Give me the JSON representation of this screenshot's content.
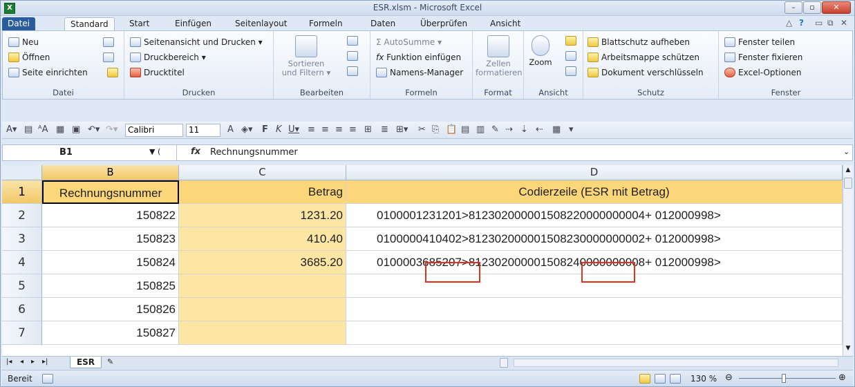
{
  "window": {
    "title": "ESR.xlsm - Microsoft Excel",
    "app_icon": "X"
  },
  "tabs": [
    "Datei",
    "Standard",
    "Start",
    "Einfügen",
    "Seitenlayout",
    "Formeln",
    "Daten",
    "Überprüfen",
    "Ansicht"
  ],
  "ribbon": {
    "datei": {
      "label": "Datei",
      "neu": "Neu",
      "oeffnen": "Öffnen",
      "seite_einrichten": "Seite einrichten"
    },
    "drucken": {
      "label": "Drucken",
      "seitenansicht": "Seitenansicht und Drucken",
      "druckbereich": "Druckbereich",
      "drucktitel": "Drucktitel"
    },
    "bearbeiten": {
      "label": "Bearbeiten",
      "sortieren": "Sortieren",
      "filtern": "und Filtern"
    },
    "formeln": {
      "label": "Formeln",
      "autosumme": "AutoSumme",
      "funktion": "Funktion einfügen",
      "namens": "Namens-Manager"
    },
    "format": {
      "label": "Format",
      "zellen": "Zellen",
      "formatieren": "formatieren"
    },
    "ansicht": {
      "label": "Ansicht",
      "zoom": "Zoom"
    },
    "schutz": {
      "label": "Schutz",
      "blattschutz": "Blattschutz aufheben",
      "arbeitsmappe": "Arbeitsmappe schützen",
      "dokument": "Dokument verschlüsseln"
    },
    "fenster": {
      "label": "Fenster",
      "teilen": "Fenster teilen",
      "fixieren": "Fenster fixieren",
      "optionen": "Excel-Optionen"
    }
  },
  "qat": {
    "font": "Calibri",
    "size": "11"
  },
  "formula_bar": {
    "name_box": "B1",
    "fx": "fx",
    "content": "Rechnungsnummer"
  },
  "columns": [
    "B",
    "C",
    "D"
  ],
  "rows": [
    {
      "num": "1",
      "b": "Rechnungsnummer",
      "c": "Betrag",
      "d": "Codierzeile (ESR mit Betrag)"
    },
    {
      "num": "2",
      "b": "150822",
      "c": "1231.20",
      "d": "0100001231201>812302000001508220000000004+ 012000998>"
    },
    {
      "num": "3",
      "b": "150823",
      "c": "410.40",
      "d": "0100000410402>812302000001508230000000002+ 012000998>"
    },
    {
      "num": "4",
      "b": "150824",
      "c": "3685.20",
      "d": "0100003685207>812302000001508240000000008+ 012000998>"
    },
    {
      "num": "5",
      "b": "150825",
      "c": "",
      "d": ""
    },
    {
      "num": "6",
      "b": "150826",
      "c": "",
      "d": ""
    },
    {
      "num": "7",
      "b": "150827",
      "c": "",
      "d": ""
    }
  ],
  "sheet": {
    "name": "ESR"
  },
  "status": {
    "ready": "Bereit",
    "zoom": "130 %"
  },
  "colors": {
    "header_fill": "#fcd77a",
    "column_c_fill": "#fde6a4",
    "highlight_box": "#e0301e"
  }
}
